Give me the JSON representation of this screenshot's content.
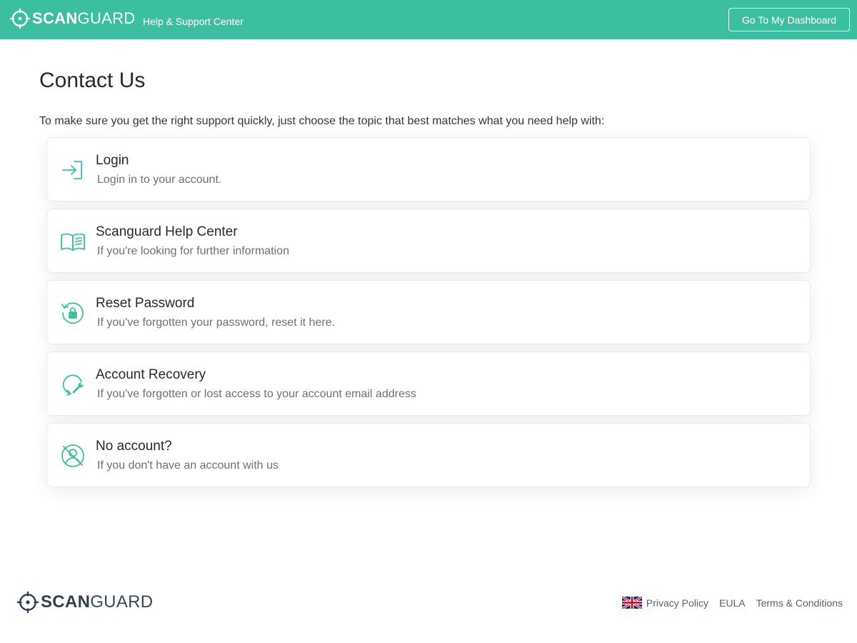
{
  "header": {
    "brand_bold": "SCAN",
    "brand_light": "GUARD",
    "subtitle": "Help & Support Center",
    "dashboard_button": "Go To My Dashboard"
  },
  "main": {
    "title": "Contact Us",
    "intro": "To make sure you get the right support quickly, just choose the topic that best matches what you need help with:",
    "cards": [
      {
        "title": "Login",
        "description": "Login in to your account.",
        "icon": "login-icon"
      },
      {
        "title": "Scanguard Help Center",
        "description": "If you're looking for further information",
        "icon": "book-icon"
      },
      {
        "title": "Reset Password",
        "description": "If you've forgotten your password, reset it here.",
        "icon": "reset-lock-icon"
      },
      {
        "title": "Account Recovery",
        "description": "If you've forgotten or lost access to your account email address",
        "icon": "recovery-wrench-icon"
      },
      {
        "title": "No account?",
        "description": "If you don't have an account with us",
        "icon": "no-user-icon"
      }
    ]
  },
  "footer": {
    "brand_bold": "SCAN",
    "brand_light": "GUARD",
    "language_icon": "uk-flag-icon",
    "links": [
      "Privacy Policy",
      "EULA",
      "Terms & Conditions"
    ]
  },
  "colors": {
    "brand": "#3bbfa0",
    "text_dark": "#222a33",
    "text_muted": "#6b7078",
    "footer_logo": "#2d3e50"
  }
}
